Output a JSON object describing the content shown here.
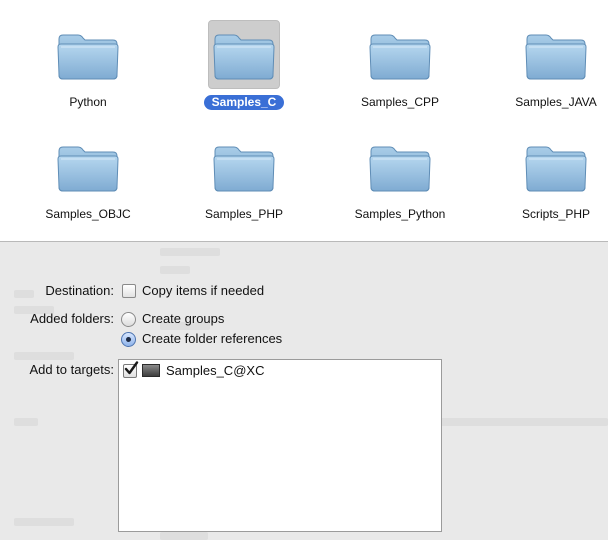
{
  "folders": [
    {
      "name": "Python",
      "selected": false
    },
    {
      "name": "Samples_C",
      "selected": true
    },
    {
      "name": "Samples_CPP",
      "selected": false
    },
    {
      "name": "Samples_JAVA",
      "selected": false
    },
    {
      "name": "Samples_OBJC",
      "selected": false
    },
    {
      "name": "Samples_PHP",
      "selected": false
    },
    {
      "name": "Samples_Python",
      "selected": false
    },
    {
      "name": "Scripts_PHP",
      "selected": false
    }
  ],
  "options": {
    "destination_label": "Destination:",
    "copy_items_label": "Copy items if needed",
    "copy_items_checked": false,
    "added_folders_label": "Added folders:",
    "create_groups_label": "Create groups",
    "create_folder_refs_label": "Create folder references",
    "selected_folder_option": "Create folder references",
    "add_to_targets_label": "Add to targets:",
    "targets": [
      {
        "name": "Samples_C@XC",
        "checked": true
      }
    ]
  },
  "colors": {
    "selection_blue": "#3a6fd6",
    "folder_blue": "#8fb9db",
    "panel_gray": "#e9e9e9"
  }
}
